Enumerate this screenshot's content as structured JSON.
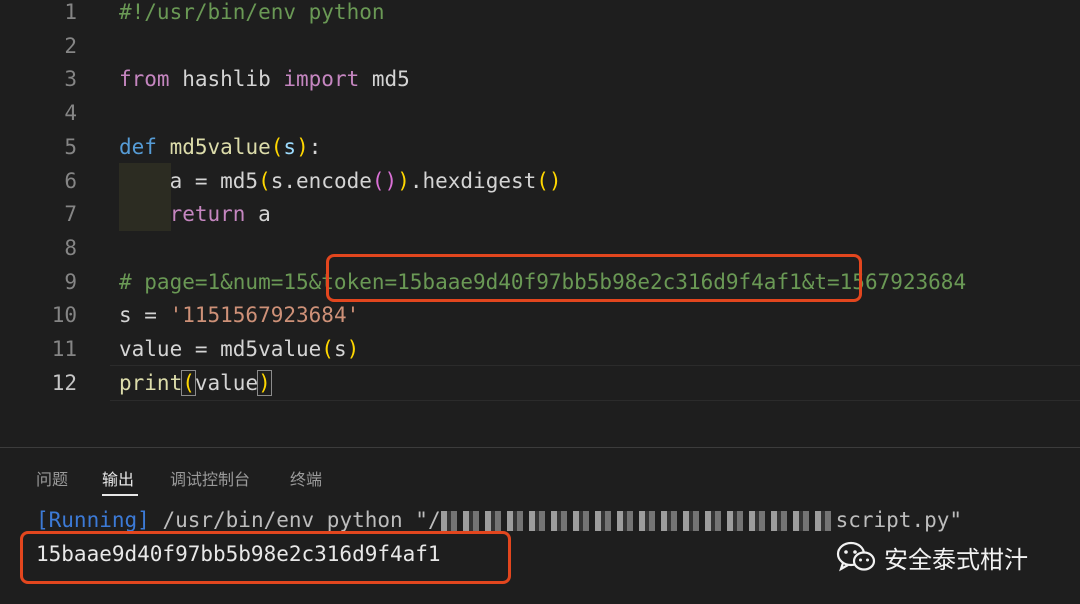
{
  "editor": {
    "lines": [
      {
        "n": "1",
        "tokens": [
          {
            "t": "#!/usr/bin/env python",
            "c": "cm"
          }
        ]
      },
      {
        "n": "2",
        "tokens": []
      },
      {
        "n": "3",
        "tokens": [
          {
            "t": "from",
            "c": "kw"
          },
          {
            "t": " hashlib ",
            "c": ""
          },
          {
            "t": "import",
            "c": "kw"
          },
          {
            "t": " md5",
            "c": ""
          }
        ]
      },
      {
        "n": "4",
        "tokens": []
      },
      {
        "n": "5",
        "tokens": [
          {
            "t": "def",
            "c": "kwb"
          },
          {
            "t": " ",
            "c": ""
          },
          {
            "t": "md5value",
            "c": "fn"
          },
          {
            "t": "(",
            "c": "br1"
          },
          {
            "t": "s",
            "c": "var"
          },
          {
            "t": ")",
            "c": "br1"
          },
          {
            "t": ":",
            "c": ""
          }
        ]
      },
      {
        "n": "6",
        "tokens": [
          {
            "t": "    a = md5",
            "c": ""
          },
          {
            "t": "(",
            "c": "br1"
          },
          {
            "t": "s.encode",
            "c": ""
          },
          {
            "t": "()",
            "c": "br2"
          },
          {
            "t": ")",
            "c": "br1"
          },
          {
            "t": ".hexdigest",
            "c": ""
          },
          {
            "t": "()",
            "c": "br1"
          }
        ]
      },
      {
        "n": "7",
        "tokens": [
          {
            "t": "    ",
            "c": ""
          },
          {
            "t": "return",
            "c": "kw"
          },
          {
            "t": " a",
            "c": ""
          }
        ]
      },
      {
        "n": "8",
        "tokens": []
      },
      {
        "n": "9",
        "tokens": [
          {
            "t": "# page=1&num=15&token=15baae9d40f97bb5b98e2c316d9f4af1&t=1567923684",
            "c": "cm"
          }
        ]
      },
      {
        "n": "10",
        "tokens": [
          {
            "t": "s = ",
            "c": ""
          },
          {
            "t": "'1151567923684'",
            "c": "str"
          }
        ]
      },
      {
        "n": "11",
        "tokens": [
          {
            "t": "value = md5value",
            "c": ""
          },
          {
            "t": "(",
            "c": "br1"
          },
          {
            "t": "s",
            "c": ""
          },
          {
            "t": ")",
            "c": "br1"
          }
        ]
      },
      {
        "n": "12",
        "tokens": [
          {
            "t": "print",
            "c": "fn"
          },
          {
            "t": "(",
            "c": "br1 brbox"
          },
          {
            "t": "value",
            "c": ""
          },
          {
            "t": ")",
            "c": "br1 brbox"
          }
        ]
      }
    ]
  },
  "panel": {
    "tabs": [
      "问题",
      "输出",
      "调试控制台",
      "终端"
    ],
    "active_tab": "输出",
    "running_label": "[Running]",
    "command_prefix": " /usr/bin/env python \"/",
    "command_suffix": "script.py\"",
    "output_value": "15baae9d40f97bb5b98e2c316d9f4af1"
  },
  "watermark": {
    "text": "安全泰式柑汁"
  },
  "colors": {
    "highlight_box": "#e2461e",
    "running": "#3c7ad6"
  }
}
